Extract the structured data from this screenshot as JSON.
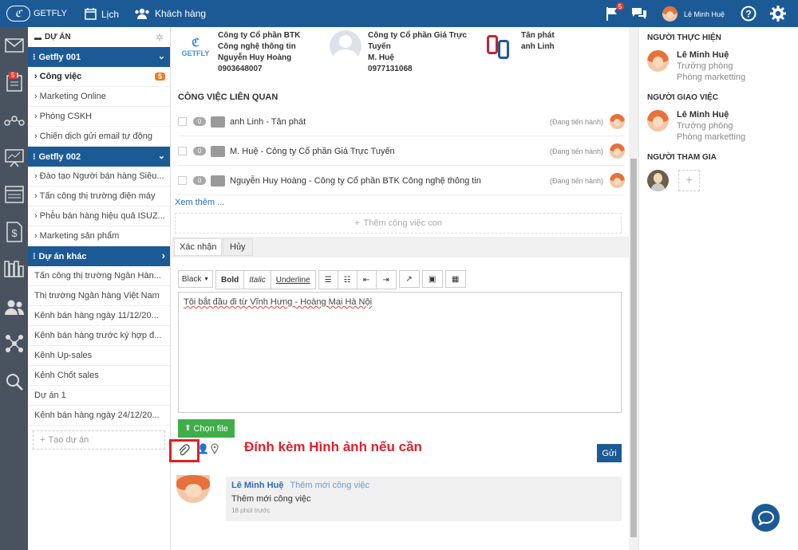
{
  "topbar": {
    "logo": "GETFLY",
    "nav": [
      "Lịch",
      "Khách hàng"
    ],
    "flag_count": "5",
    "user": "Lê Minh Huệ"
  },
  "leftbar": {
    "badge": "5"
  },
  "projects": {
    "header": "DỰ ÁN",
    "group1": "Getfly 001",
    "group1_items": [
      {
        "label": "Công việc",
        "badge": "5"
      },
      {
        "label": "Marketing Online"
      },
      {
        "label": "Phòng CSKH"
      },
      {
        "label": "Chiến dịch gửi email tự động"
      }
    ],
    "group2": "Getfly 002",
    "group2_items": [
      "Đào tạo Người bán hàng Siêu...",
      "Tấn công thị trường điện máy",
      "Phễu bán hàng hiệu quả ISUZ...",
      "Marketing sản phẩm"
    ],
    "group3": "Dự án khác",
    "group3_items": [
      "Tấn công thị trường Ngân Hàn...",
      "Thị trường Ngân hàng Việt Nam",
      "Kênh bán hàng ngày 11/12/20...",
      "Kênh bán hàng trước ký hợp đ...",
      "Kênh Up-sales",
      "Kênh Chốt sales",
      "Dự án 1",
      "Kênh bán hàng ngày 24/12/20..."
    ],
    "add": "Tạo dự án"
  },
  "contacts": [
    {
      "logo": "GETFLY",
      "company": "Công ty Cổ phần BTK Công nghệ thông tin",
      "person": "Nguyễn Huy Hoàng",
      "phone": "0903648007"
    },
    {
      "company": "Công ty Cổ phần Giá Trực Tuyến",
      "person": "M. Huệ",
      "phone": "0977131068"
    },
    {
      "company": "Tân phát",
      "person": "anh Linh"
    }
  ],
  "related": {
    "title": "CÔNG VIỆC LIÊN QUAN",
    "tasks": [
      {
        "count": "0",
        "name": "anh Linh - Tân phát",
        "status": "(Đang tiến hành)"
      },
      {
        "count": "0",
        "name": "M. Huệ - Công ty Cổ phần Giá Trực Tuyến",
        "status": "(Đang tiến hành)"
      },
      {
        "count": "0",
        "name": "Nguyễn Huy Hoàng - Công ty Cổ phần BTK Công nghệ thông tin",
        "status": "(Đang tiến hành)"
      }
    ],
    "more": "Xem thêm ...",
    "add_sub": "Thêm công việc con"
  },
  "tabs": [
    "Xác nhận",
    "Hủy"
  ],
  "toolbar": {
    "color": "Black",
    "bold": "Bold",
    "italic": "Italic",
    "underline": "Underline"
  },
  "editor_text": "Tôi bắt đầu đi từ Vĩnh Hưng - Hoàng Mai Hà Nội",
  "choose_file": "Chọn file",
  "annotation": "Đính kèm Hình ảnh nếu cần",
  "send": "Gửi",
  "comment": {
    "author": "Lê Minh Huệ",
    "action": "Thêm mới công việc",
    "text": "Thêm mới công việc",
    "time": "18 phút trước"
  },
  "right": {
    "performer_title": "NGƯỜI THỰC HIỆN",
    "performer": {
      "name": "Lê Minh Huệ",
      "line1": "Trưởng phòng",
      "line2": "Phòng marketting"
    },
    "assigner_title": "NGƯỜI GIAO VIỆC",
    "assigner": {
      "name": "Lê Minh Huệ",
      "line1": "Trưởng phòng",
      "line2": "Phòng marketting"
    },
    "participant_title": "NGƯỜI THAM GIA"
  },
  "colors": {
    "brand": "#1c5a96",
    "green": "#3fae49",
    "orange": "#f07a25",
    "red": "#e23a3a"
  }
}
